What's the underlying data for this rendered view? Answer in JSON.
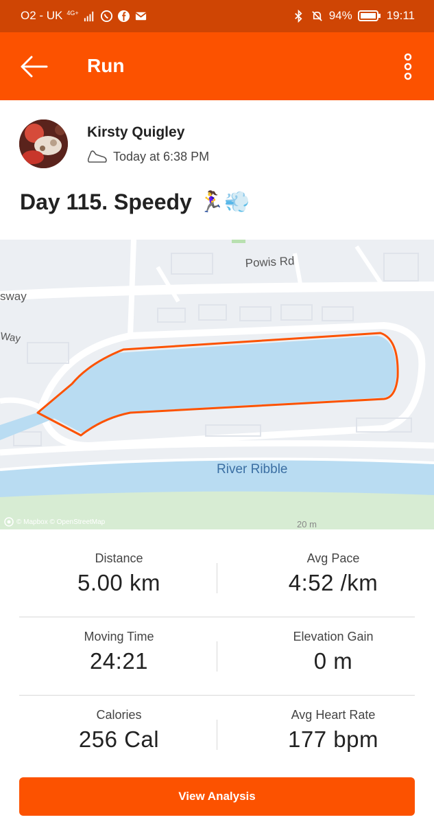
{
  "status_bar": {
    "carrier": "O2 - UK",
    "network": "4G+",
    "battery": "94%",
    "time": "19:11"
  },
  "header": {
    "title": "Run"
  },
  "athlete": {
    "name": "Kirsty Quigley",
    "timestamp": "Today at 6:38 PM"
  },
  "activity": {
    "title": "Day 115. Speedy",
    "emoji": "🏃‍♀️💨"
  },
  "map": {
    "labels": {
      "road1": "Powis Rd",
      "road2": "sway",
      "road3": "Way",
      "river": "River Ribble"
    },
    "attribution": "© Mapbox © OpenStreetMap",
    "scale": "20 m",
    "route_color": "#fc5200",
    "water_color": "#b9dcf2"
  },
  "stats": [
    {
      "label": "Distance",
      "value": "5.00 km"
    },
    {
      "label": "Avg Pace",
      "value": "4:52 /km"
    },
    {
      "label": "Moving Time",
      "value": "24:21"
    },
    {
      "label": "Elevation Gain",
      "value": "0 m"
    },
    {
      "label": "Calories",
      "value": "256 Cal"
    },
    {
      "label": "Avg Heart Rate",
      "value": "177 bpm"
    }
  ],
  "cta": {
    "label": "View Analysis"
  },
  "colors": {
    "brand": "#fc5200",
    "status_bar": "#cf4504"
  }
}
